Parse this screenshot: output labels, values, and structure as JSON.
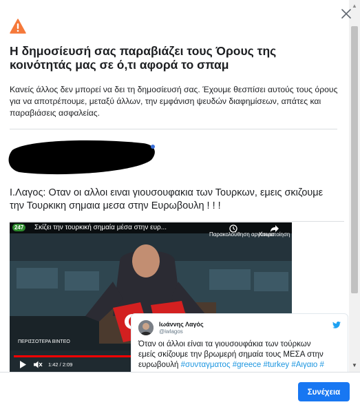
{
  "dialog": {
    "title": "Η δημοσίευσή σας παραβιάζει τους Όρους της κοινότητάς μας σε ό,τι αφορά το σπαμ",
    "description": "Κανείς άλλος δεν μπορεί να δει τη δημοσίευσή σας. Έχουμε θεσπίσει αυτούς τους όρους για να αποτρέπουμε, μεταξύ άλλων, την εμφάνιση ψευδών διαφημίσεων, απάτες και παραβιάσεις ασφαλείας.",
    "continue_label": "Συνέχεια"
  },
  "post": {
    "text": "Ι.Λαγος: Οταν οι αλλοι ειναι γιουσουφακια των Τουρκων, εμεις σκιζουμε την Τουρκικη σημαια μεσα στην Ευρωβουλη ! ! !"
  },
  "video": {
    "channel_badge": "247",
    "title": "Σκίζει την τουρκική σημαία μέσα στην ευρ...",
    "watch_later_label": "Παρακολούθηση αργότερα",
    "share_label": "Κοινοποίηση",
    "more_videos_label": "ΠΕΡΙΣΣΟΤΕΡΑ ΒΙΝΤΕΟ",
    "time": "1:42 / 2:09",
    "progress": 0.79
  },
  "tweet": {
    "name": "Ιωάννης Λαγός",
    "handle": "@iwlagos",
    "text_line1": "Όταν οι άλλοι είναι τα γιουσουφάκια των τούρκων",
    "text_line2": "εμείς σκίζουμε την βρωμερή σημαία τους ΜΕΣΑ στην",
    "text_line3_plain": "ευρωβουλή",
    "hashtags": "#συνταγματος #greece #turkey #Αιγαιο #"
  },
  "icons": {
    "warning": "warning-triangle-icon",
    "close": "close-icon"
  },
  "colors": {
    "accent": "#1877f2",
    "warning": "#f5793a"
  }
}
